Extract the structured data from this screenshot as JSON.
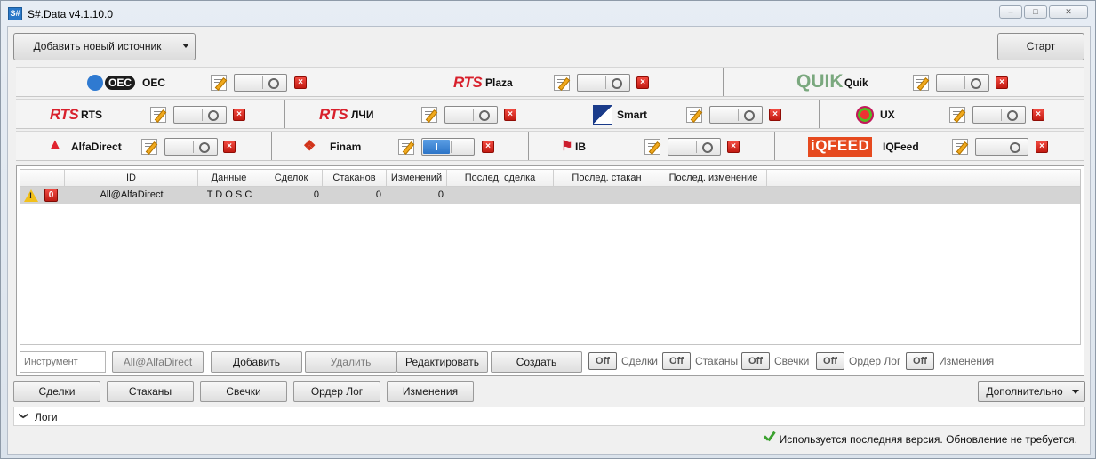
{
  "window": {
    "title": "S#.Data v4.1.10.0",
    "icon_label": "S#",
    "controls": [
      "minimize",
      "maximize",
      "close"
    ]
  },
  "toolbar": {
    "add_source_label": "Добавить новый источник",
    "start_label": "Старт"
  },
  "sources": {
    "row1": [
      {
        "name": "OEC",
        "logo_text": "OEC",
        "enabled": false
      },
      {
        "name": "Plaza",
        "logo_text": "RTS",
        "enabled": false
      },
      {
        "name": "Quik",
        "logo_text": "QUIK",
        "enabled": false
      }
    ],
    "row2": [
      {
        "name": "RTS",
        "logo_text": "RTS",
        "enabled": false
      },
      {
        "name": "ЛЧИ",
        "logo_text": "RTS",
        "enabled": false
      },
      {
        "name": "Smart",
        "logo_text": "",
        "enabled": false
      },
      {
        "name": "UX",
        "logo_text": "",
        "enabled": false
      }
    ],
    "row3": [
      {
        "name": "AlfaDirect",
        "logo_text": "",
        "enabled": false
      },
      {
        "name": "Finam",
        "logo_text": "",
        "enabled": true
      },
      {
        "name": "IB",
        "logo_text": "",
        "enabled": false
      },
      {
        "name": "IQFeed",
        "logo_text": "iQFEED",
        "enabled": false
      }
    ]
  },
  "grid": {
    "columns": [
      "",
      "ID",
      "Данные",
      "Сделок",
      "Стаканов",
      "Изменений",
      "Послед. сделка",
      "Послед. стакан",
      "Послед. изменение"
    ],
    "rows": [
      {
        "id": "All@AlfaDirect",
        "data": "T D O S C",
        "trades": "0",
        "depths": "0",
        "changes": "0",
        "last_trade": "",
        "last_depth": "",
        "last_change": ""
      }
    ]
  },
  "grid_toolbar": {
    "instrument_placeholder": "Инструмент",
    "selected_security": "All@AlfaDirect",
    "add_label": "Добавить",
    "delete_label": "Удалить",
    "edit_label": "Редактировать",
    "create_label": "Создать",
    "toggles": [
      {
        "state": "Off",
        "label": "Сделки"
      },
      {
        "state": "Off",
        "label": "Стаканы"
      },
      {
        "state": "Off",
        "label": "Свечки"
      },
      {
        "state": "Off",
        "label": "Ордер Лог"
      },
      {
        "state": "Off",
        "label": "Изменения"
      }
    ]
  },
  "tabs": {
    "trades": "Сделки",
    "depths": "Стаканы",
    "candles": "Свечки",
    "orderlog": "Ордер Лог",
    "changes": "Изменения",
    "more": "Дополнительно"
  },
  "logs": {
    "label": "Логи"
  },
  "status": {
    "text": "Используется последняя версия. Обновление не требуется."
  },
  "colors": {
    "accent_toggle_on": "#2c74c7",
    "delete_red": "#c21b12",
    "rts_red": "#d8202c",
    "iqfeed_orange": "#e64a1f",
    "status_green": "#3ba12f"
  }
}
